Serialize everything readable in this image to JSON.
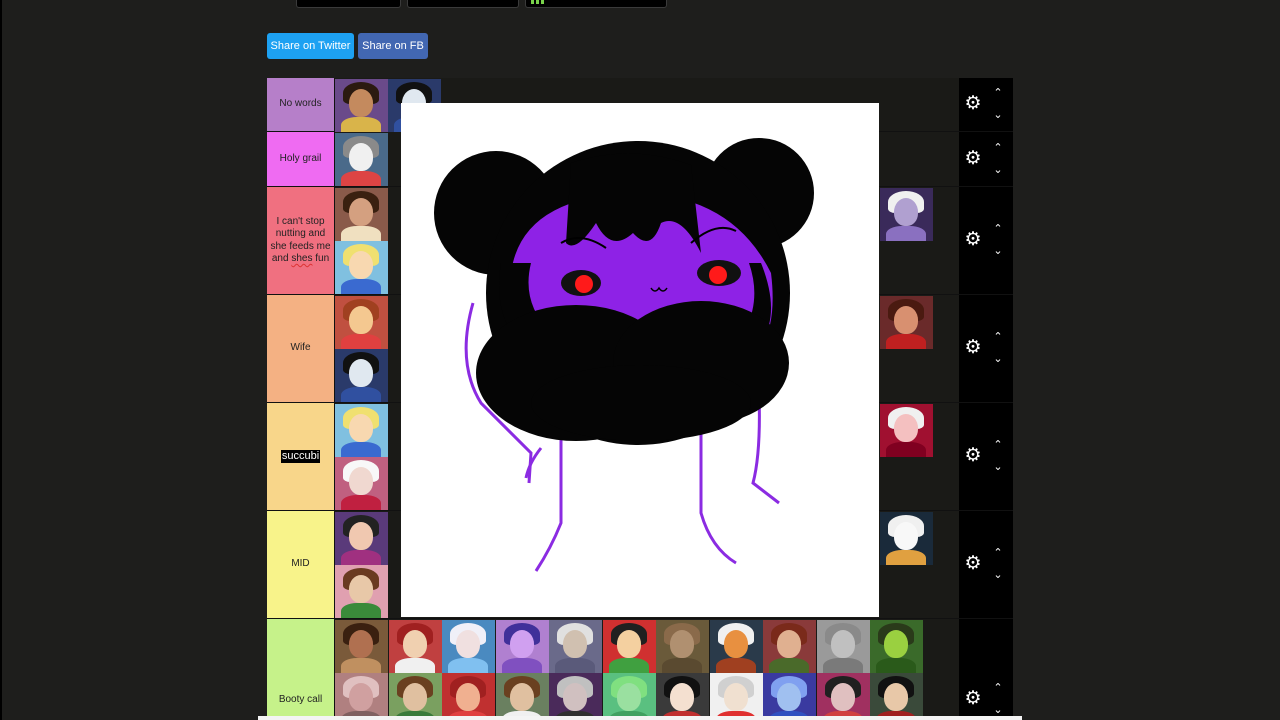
{
  "share": {
    "twitter_label": "Share on Twitter",
    "fb_label": "Share on FB"
  },
  "tiers": [
    {
      "label": "No words",
      "color": "#b67fc9"
    },
    {
      "label": "Holy grail",
      "color": "#ef6bf2"
    },
    {
      "label_parts": [
        "I can't stop nutting and she feeds me and ",
        "shes",
        " fun"
      ],
      "color": "#f07080"
    },
    {
      "label": "Wife",
      "color": "#f4b183"
    },
    {
      "label": "succubi",
      "color": "#f8d68a"
    },
    {
      "label": "MID",
      "color": "#f8f38a"
    },
    {
      "label": "Booty call",
      "color": "#c6f28a"
    }
  ],
  "icons": {
    "settings": "gear-icon",
    "up": "chevron-up-icon",
    "down": "chevron-down-icon"
  }
}
